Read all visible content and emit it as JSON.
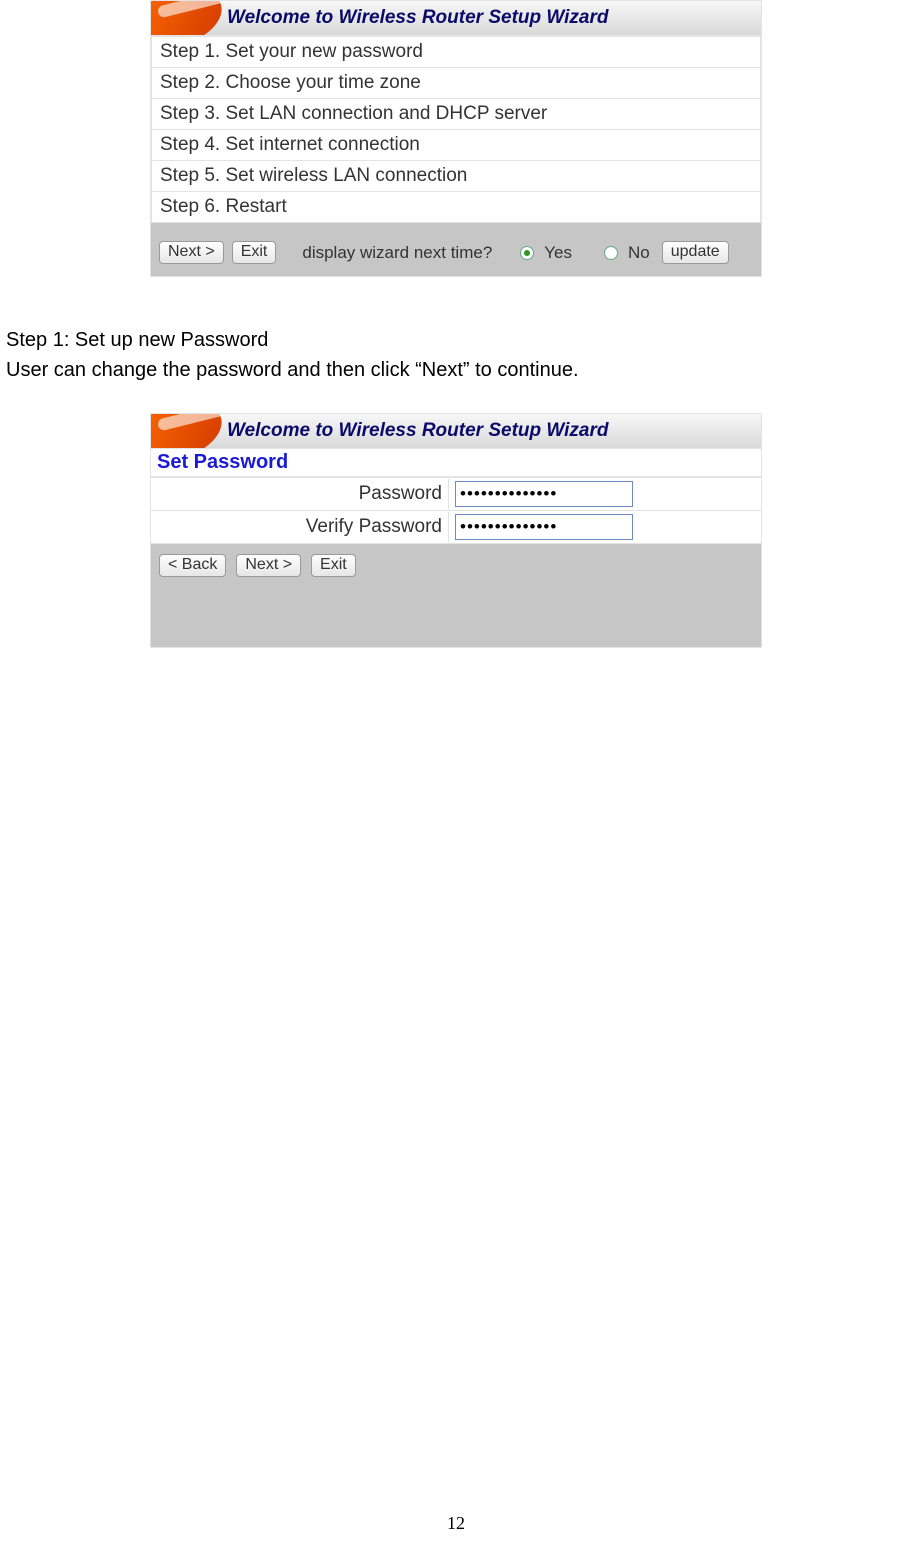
{
  "banner_title": "Welcome to Wireless Router Setup Wizard",
  "steps": [
    "Step 1. Set your new password",
    "Step 2. Choose your time zone",
    "Step 3. Set LAN connection and DHCP server",
    "Step 4. Set internet connection",
    "Step 5. Set wireless LAN connection",
    "Step 6. Restart"
  ],
  "buttons": {
    "next": "Next >",
    "exit": "Exit",
    "back": "< Back",
    "update": "update"
  },
  "question": "display wizard next time?",
  "options": {
    "yes": "Yes",
    "no": "No"
  },
  "doc": {
    "step_heading": "Step 1: Set up new Password",
    "step_body": "User can change the password and then click “Next” to continue."
  },
  "section_title": "Set Password",
  "form": {
    "password_label": "Password",
    "verify_label": "Verify Password",
    "password_value": "••••••••••••••",
    "verify_value": "••••••••••••••"
  },
  "page_number": "12"
}
